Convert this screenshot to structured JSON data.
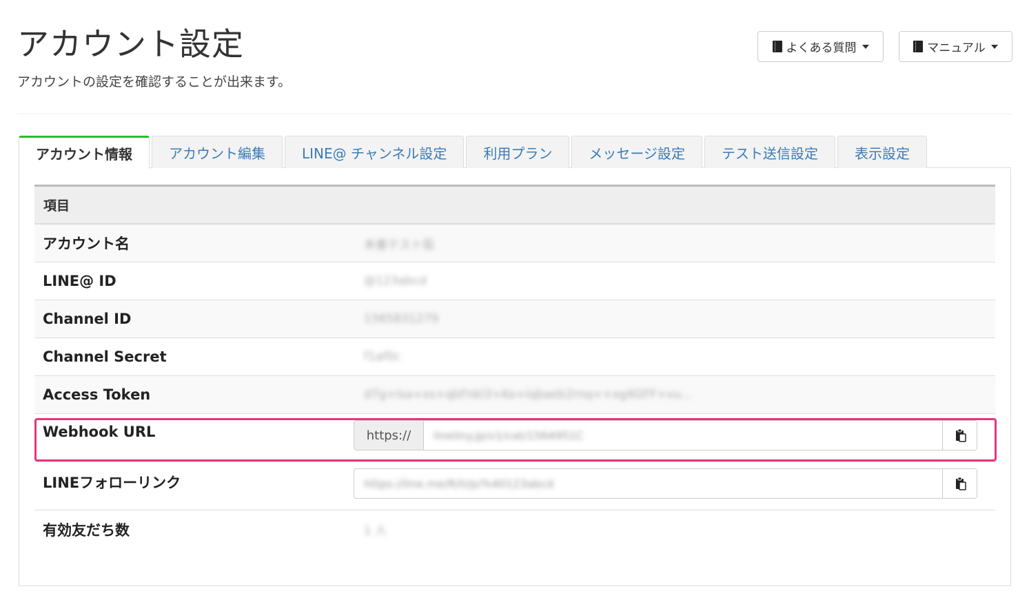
{
  "header": {
    "title": "アカウント設定",
    "subtitle": "アカウントの設定を確認することが出来ます。",
    "faq_button": "よくある質問",
    "manual_button": "マニュアル"
  },
  "tabs": [
    {
      "label": "アカウント情報",
      "active": true
    },
    {
      "label": "アカウント編集",
      "active": false
    },
    {
      "label": "LINE@ チャンネル設定",
      "active": false
    },
    {
      "label": "利用プラン",
      "active": false
    },
    {
      "label": "メッセージ設定",
      "active": false
    },
    {
      "label": "テスト送信設定",
      "active": false
    },
    {
      "label": "表示設定",
      "active": false
    }
  ],
  "table": {
    "header": "項目",
    "rows": [
      {
        "label": "アカウント名",
        "value": "本番テスト垢"
      },
      {
        "label": "LINE@ ID",
        "value": "@123abcd"
      },
      {
        "label": "Channel ID",
        "value": "1565831279"
      },
      {
        "label": "Channel Secret",
        "value": "f1af0c"
      },
      {
        "label": "Access Token",
        "value": "d7g+lsa+xs+qbFnkl3+Ko+lqbaeb2rnq++xg4GFF+vu..."
      }
    ],
    "webhook": {
      "label": "Webhook URL",
      "prefix": "https://",
      "value": "lineliny.jp/v1/cat/1564951C"
    },
    "follow": {
      "label": "LINEフォローリンク",
      "value": "https://line.me/R/ti/p/%40123abcd"
    },
    "friends": {
      "label": "有効友だち数",
      "value": "1 人"
    }
  },
  "colors": {
    "active_tab_border": "#2eb82e",
    "tab_link": "#3a7bb8",
    "highlight": "#e8357a"
  }
}
